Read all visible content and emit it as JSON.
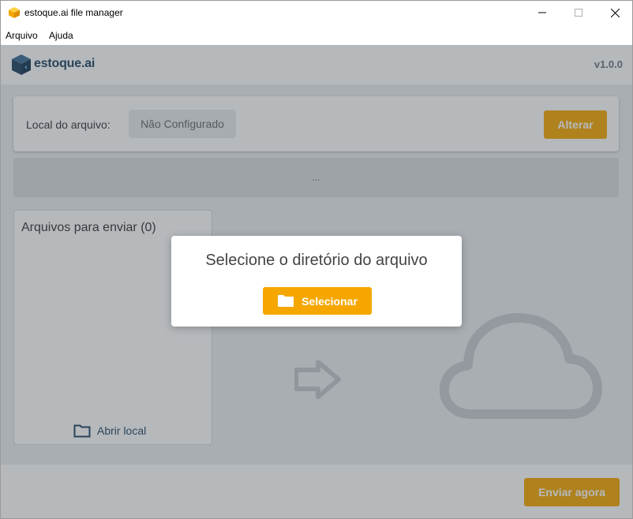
{
  "window": {
    "title": "estoque.ai file manager",
    "icon": "package-icon"
  },
  "menu": {
    "items": [
      {
        "label": "Arquivo"
      },
      {
        "label": "Ajuda"
      }
    ]
  },
  "header": {
    "logo_text": "estoque.ai",
    "version": "v1.0.0"
  },
  "location": {
    "label": "Local do arquivo:",
    "value": "Não Configurado",
    "change_button": "Alterar"
  },
  "status_bar": {
    "text": "..."
  },
  "files": {
    "title": "Arquivos para enviar (0)",
    "open_local": "Abrir local"
  },
  "footer": {
    "send_button": "Enviar agora"
  },
  "modal": {
    "title": "Selecione o diretório do arquivo",
    "select_button": "Selecionar"
  },
  "colors": {
    "accent": "#f5a700",
    "brand": "#1f4160"
  }
}
